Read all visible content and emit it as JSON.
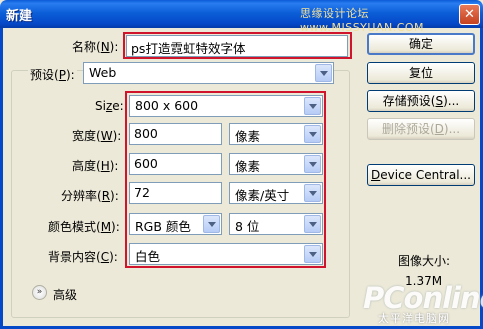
{
  "window": {
    "title": "新建",
    "watermark": "思缘设计论坛 www.MISSYUAN.COM",
    "close_glyph": "✕"
  },
  "form": {
    "name": {
      "label": "名称(",
      "key": "N",
      "label_end": "):",
      "value": "ps打造霓虹特效字体"
    },
    "preset": {
      "label": "预设(",
      "key": "P",
      "label_end": "):",
      "value": "Web"
    },
    "size": {
      "label": "Si",
      "key": "z",
      "label_end": "e:",
      "value": "800 x 600"
    },
    "width": {
      "label": "宽度(",
      "key": "W",
      "label_end": "):",
      "value": "800",
      "unit": "像素"
    },
    "height": {
      "label": "高度(",
      "key": "H",
      "label_end": "):",
      "value": "600",
      "unit": "像素"
    },
    "resolution": {
      "label": "分辨率(",
      "key": "R",
      "label_end": "):",
      "value": "72",
      "unit": "像素/英寸"
    },
    "color_mode": {
      "label": "颜色模式(",
      "key": "M",
      "label_end": "):",
      "value": "RGB 颜色",
      "depth": "8 位"
    },
    "background": {
      "label": "背景内容(",
      "key": "C",
      "label_end": "):",
      "value": "白色"
    },
    "advanced": {
      "label": "高级",
      "icon": "»"
    }
  },
  "buttons": {
    "ok": "确定",
    "reset": "复位",
    "save_preset": {
      "pre": "存储预设(",
      "key": "S",
      "post": ")..."
    },
    "delete_preset": {
      "pre": "删除预设(",
      "key": "D",
      "post": ")..."
    },
    "device_central": {
      "key": "D",
      "post": "evice Central..."
    }
  },
  "info": {
    "image_size_label": "图像大小:",
    "image_size_value": "1.37M"
  },
  "watermark": {
    "logo": "PConline",
    "tagline": "太平洋电脑网"
  }
}
